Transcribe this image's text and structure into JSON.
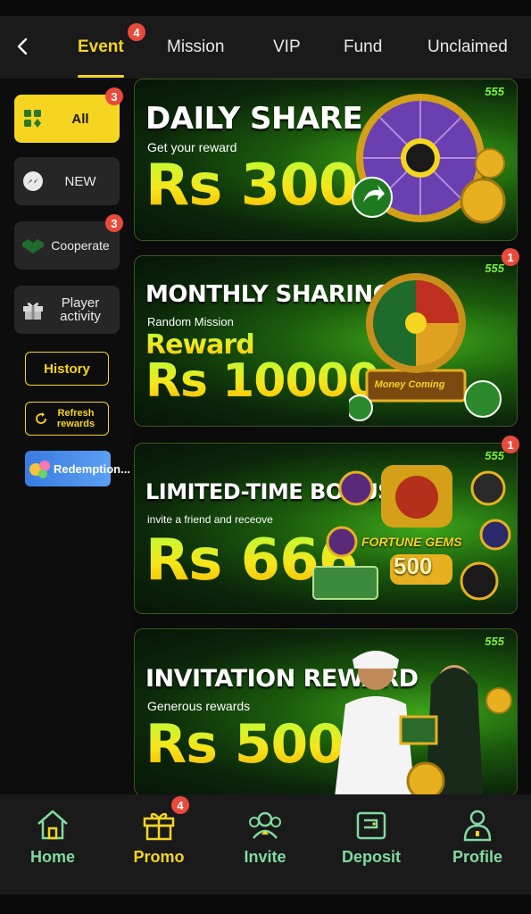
{
  "header": {
    "tabs": [
      {
        "label": "Event",
        "badge": "4"
      },
      {
        "label": "Mission"
      },
      {
        "label": "VIP"
      },
      {
        "label": "Fund"
      },
      {
        "label": "Unclaimed"
      }
    ]
  },
  "sidebar": {
    "items": [
      {
        "label": "All",
        "badge": "3",
        "icon": "grid-icon"
      },
      {
        "label": "NEW",
        "icon": "messenger-icon"
      },
      {
        "label": "Cooperate",
        "badge": "3",
        "icon": "handshake-icon"
      },
      {
        "label": "Player activity",
        "icon": "gift-icon"
      }
    ],
    "history_label": "History",
    "refresh_label": "Refresh rewards",
    "redemption_label": "Redemption..."
  },
  "banners": [
    {
      "title": "DAILY SHARE",
      "subtitle": "Get your reward",
      "amount": "Rs 300",
      "badge": ""
    },
    {
      "title": "MONTHLY SHARING",
      "subtitle": "Random Mission",
      "reward_label": "Reward",
      "amount": "Rs 10000",
      "badge": "1",
      "wheel_caption": "Money Coming"
    },
    {
      "title": "LIMITED-TIME BONUS",
      "subtitle": "invite a friend and receove",
      "amount": "Rs 666",
      "badge": "1",
      "game_name": "FORTUNE GEMS",
      "game_number": "500"
    },
    {
      "title": "INVITATION REWARD",
      "subtitle": "Generous rewards",
      "amount": "Rs 5000",
      "badge": ""
    }
  ],
  "bottom_nav": [
    {
      "label": "Home",
      "icon": "home-icon"
    },
    {
      "label": "Promo",
      "icon": "gift-box-icon",
      "badge": "4"
    },
    {
      "label": "Invite",
      "icon": "people-icon"
    },
    {
      "label": "Deposit",
      "icon": "wallet-icon"
    },
    {
      "label": "Profile",
      "icon": "user-icon"
    }
  ],
  "brand_logo": "555",
  "colors": {
    "accent": "#f6d521",
    "nav_text": "#7fdba0",
    "badge": "#e84a3c",
    "banner_green": "#1b5b0c"
  }
}
